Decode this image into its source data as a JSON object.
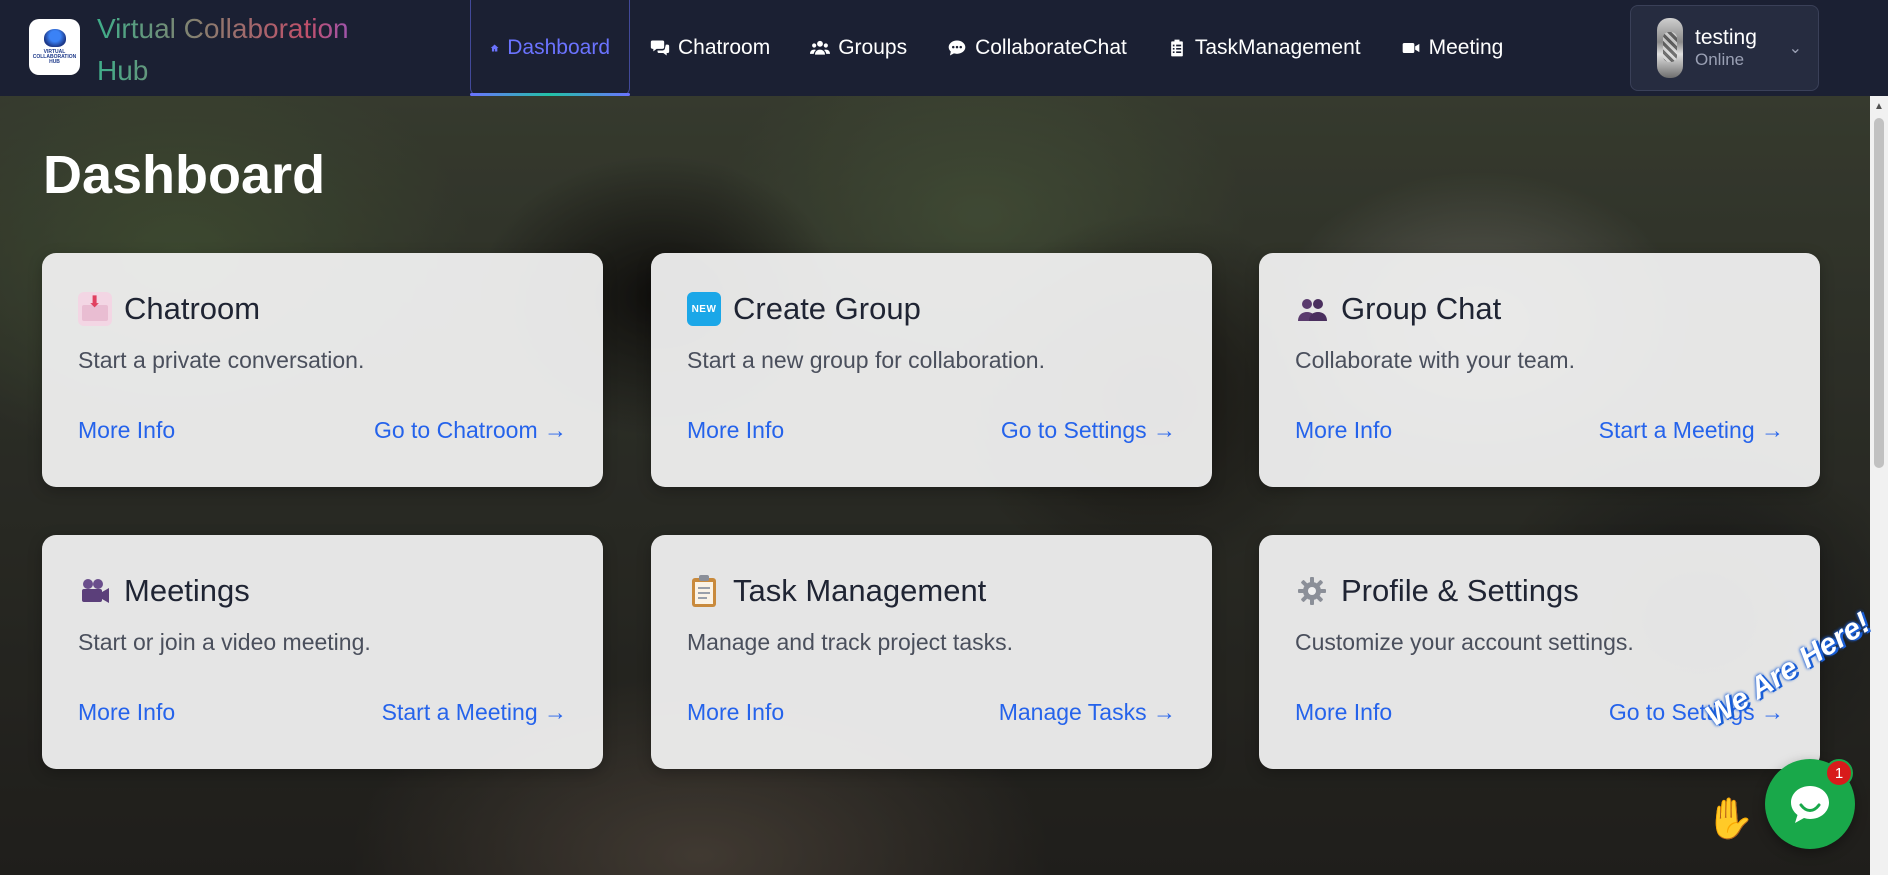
{
  "brand": {
    "line1": "Virtual Collaboration",
    "line2": "Hub",
    "logo_text": "VIRTUAL COLLABORATION HUB"
  },
  "nav": {
    "items": [
      {
        "label": "Dashboard",
        "icon": "home-icon",
        "active": true
      },
      {
        "label": "Chatroom",
        "icon": "chat-bubbles-icon",
        "active": false
      },
      {
        "label": "Groups",
        "icon": "users-icon",
        "active": false
      },
      {
        "label": "CollaborateChat",
        "icon": "comment-dots-icon",
        "active": false
      },
      {
        "label": "TaskManagement",
        "icon": "clipboard-list-icon",
        "active": false
      },
      {
        "label": "Meeting",
        "icon": "video-camera-icon",
        "active": false
      }
    ]
  },
  "user": {
    "name": "testing",
    "status": "Online"
  },
  "page": {
    "title": "Dashboard"
  },
  "cards": [
    {
      "title": "Chatroom",
      "icon": "incoming-envelope-icon",
      "desc": "Start a private conversation.",
      "more": "More Info",
      "go": "Go to Chatroom →"
    },
    {
      "title": "Create Group",
      "icon": "new-badge-icon",
      "icon_text": "NEW",
      "desc": "Start a new group for collaboration.",
      "more": "More Info",
      "go": "Go to Settings →"
    },
    {
      "title": "Group Chat",
      "icon": "busts-icon",
      "desc": "Collaborate with your team.",
      "more": "More Info",
      "go": "Start a Meeting →"
    },
    {
      "title": "Meetings",
      "icon": "movie-camera-icon",
      "desc": "Start or join a video meeting.",
      "more": "More Info",
      "go": "Start a Meeting →"
    },
    {
      "title": "Task Management",
      "icon": "clipboard-icon",
      "desc": "Manage and track project tasks.",
      "more": "More Info",
      "go": "Manage Tasks →"
    },
    {
      "title": "Profile & Settings",
      "icon": "gear-icon",
      "desc": "Customize your account settings.",
      "more": "More Info",
      "go": "Go to Settings →"
    }
  ],
  "chat_widget": {
    "tagline": "We Are Here!",
    "badge_count": "1",
    "color": "#19a84a"
  },
  "colors": {
    "navbar": "#1b2033",
    "active_nav": "#6b73ff",
    "link": "#2563eb"
  }
}
